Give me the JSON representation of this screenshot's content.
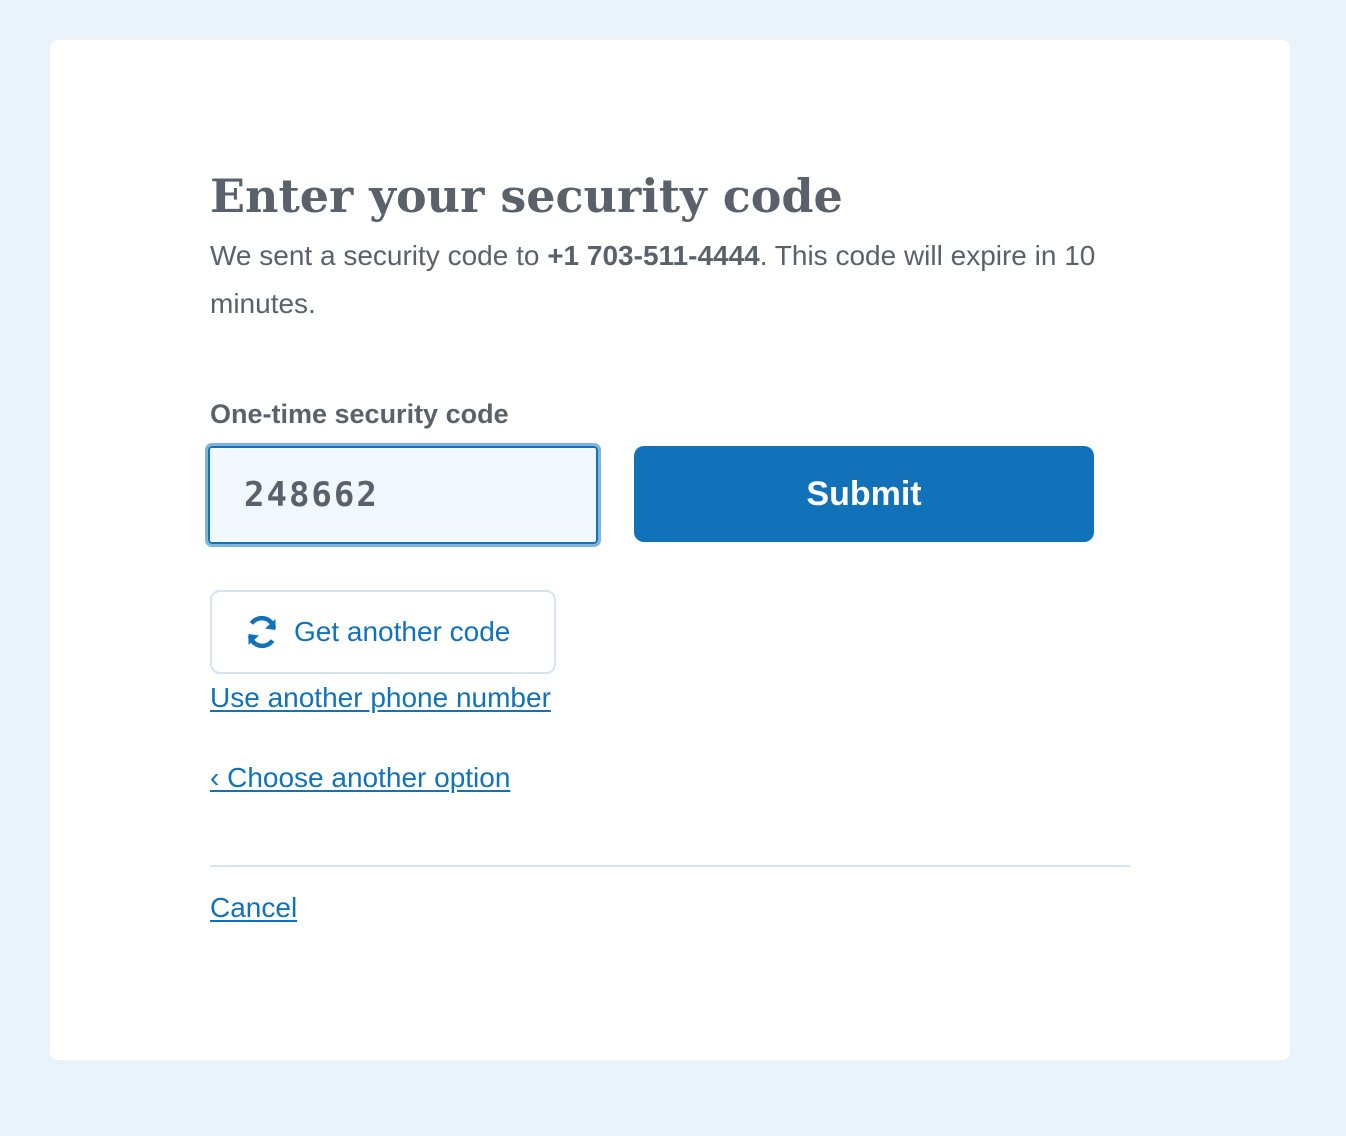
{
  "page": {
    "title": "Enter your security code",
    "intro_prefix": "We sent a security code to ",
    "phone_number": "+1 703-511-4444",
    "intro_suffix": ". This code will expire in 10 minutes."
  },
  "form": {
    "field_label": "One-time security code",
    "code_value": "248662",
    "submit_label": "Submit"
  },
  "actions": {
    "resend_label": "Get another code",
    "resend_icon": "refresh-icon",
    "phone_link": "Use another phone number",
    "option_link": "‹ Choose another option",
    "cancel_link": "Cancel"
  },
  "colors": {
    "background": "#eaf2fa",
    "card": "#ffffff",
    "primary": "#1172b9",
    "text": "#5b616b",
    "divider": "#d6e2ee"
  }
}
